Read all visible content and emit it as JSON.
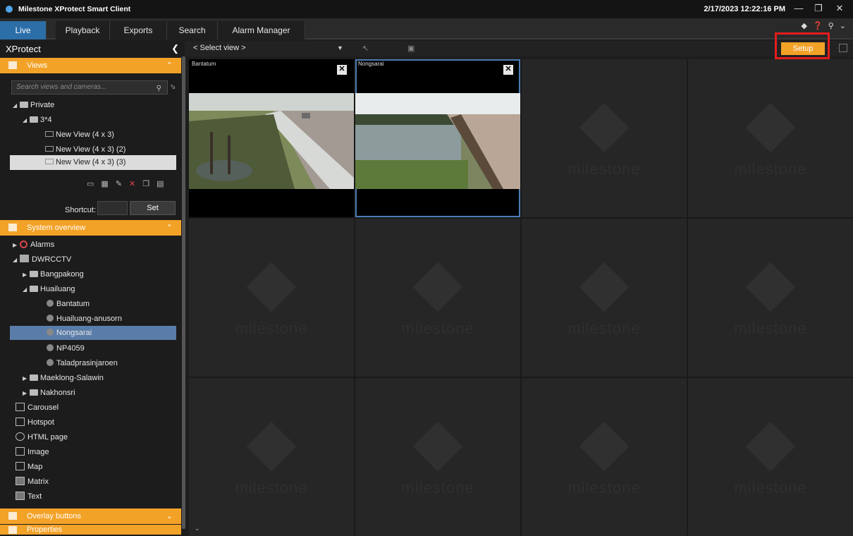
{
  "window": {
    "title": "Milestone XProtect Smart Client",
    "datetime": "2/17/2023 12:22:16 PM"
  },
  "tabs": [
    "Live",
    "Playback",
    "Exports",
    "Search",
    "Alarm Manager"
  ],
  "sidebar": {
    "title": "XProtect",
    "views_panel": {
      "label": "Views",
      "search_placeholder": "Search views and cameras...",
      "tree": [
        "Private",
        "3*4",
        "New View (4 x 3)",
        "New View (4 x 3) (2)",
        "New View (4 x 3) (3)"
      ],
      "shortcut_label": "Shortcut:",
      "set_button": "Set"
    },
    "system_panel": {
      "label": "System overview",
      "tree": [
        "Alarms",
        "DWRCCTV",
        "Bangpakong",
        "Huailuang",
        "Bantatum",
        "Huailuang-anusorn",
        "Nongsarai",
        "NP4059",
        "Taladprasinjaroen",
        "Maeklong-Salawin",
        "Nakhonsri",
        "Carousel",
        "Hotspot",
        "HTML page",
        "Image",
        "Map",
        "Matrix",
        "Text"
      ]
    },
    "overlay_panel": {
      "label": "Overlay buttons"
    },
    "properties_panel": {
      "label": "Properties"
    }
  },
  "viewbar": {
    "select_view": "< Select view >",
    "setup_button": "Setup"
  },
  "cameras": [
    {
      "label": "Bantatum",
      "close": "✕"
    },
    {
      "label": "Nongsarai",
      "close": "✕"
    }
  ],
  "empty_logo_text": "milestone",
  "colors": {
    "accent": "#f3a228",
    "active_tab": "#2c6ea8",
    "highlight": "#e51c1c"
  }
}
